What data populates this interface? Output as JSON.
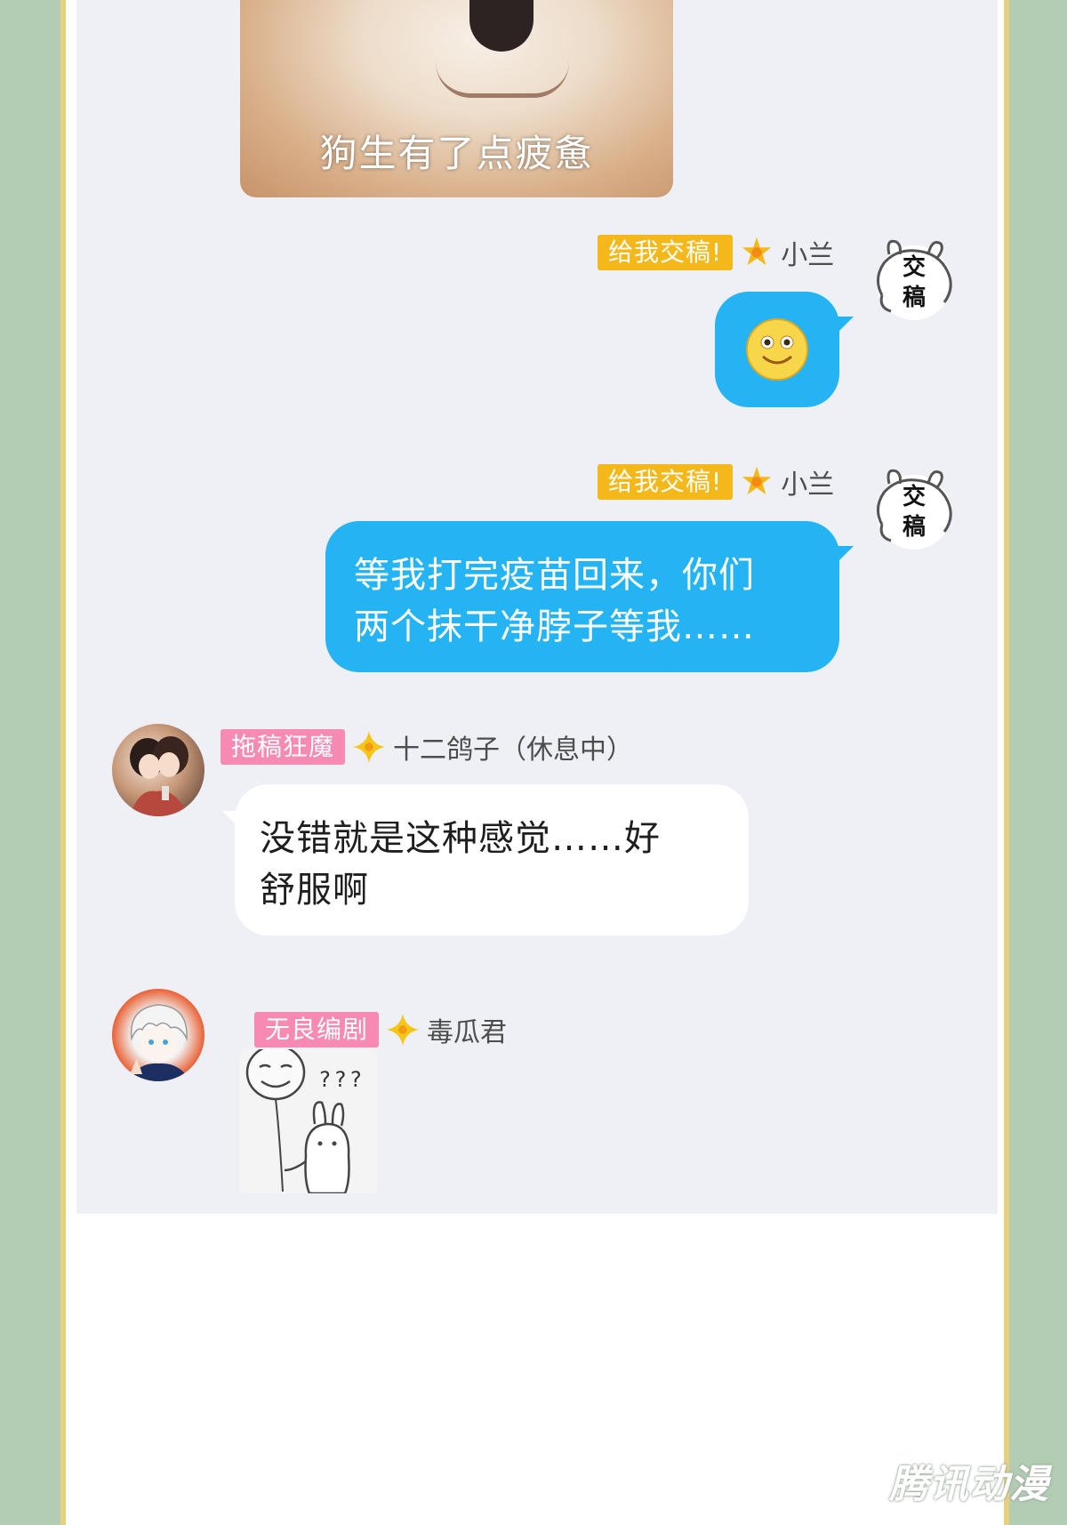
{
  "top_image": {
    "caption": "狗生有了点疲惫"
  },
  "messages": [
    {
      "tag": "给我交稿!",
      "name": "小兰",
      "avatar_text": [
        "交",
        "稿"
      ],
      "content_type": "emoji",
      "emoji": "smiley-face"
    },
    {
      "tag": "给我交稿!",
      "name": "小兰",
      "avatar_text": [
        "交",
        "稿"
      ],
      "content_type": "text",
      "lines": [
        "等我打完疫苗回来，你们",
        "两个抹干净脖子等我……"
      ]
    },
    {
      "tag": "拖稿狂魔",
      "name": "十二鸽子（休息中）",
      "content_type": "text",
      "lines": [
        "没错就是这种感觉……好",
        "舒服啊"
      ]
    },
    {
      "tag": "无良编剧",
      "name": "毒瓜君",
      "content_type": "sticker",
      "sticker_text": "???"
    }
  ],
  "watermark": "腾讯动漫",
  "colors": {
    "bubble_blue": "#25b4f3",
    "tag_yellow": "#f5b81b",
    "tag_pink": "#f68ab2",
    "frame_gold": "#e9cf7c",
    "background_green": "#b2cdb4",
    "chat_bg": "#eef0f5"
  }
}
